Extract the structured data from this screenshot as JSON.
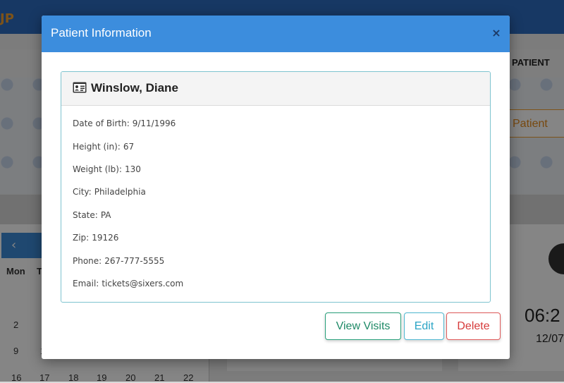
{
  "background": {
    "brand_fragment": "JP",
    "patient_tab": "PATIENT",
    "new_patient_fragment": "w Patient",
    "calendar": {
      "prev": "‹",
      "day_mon": "Mon",
      "day_tue": "T",
      "row1": [
        "2"
      ],
      "row2": [
        "9",
        "1"
      ],
      "row3": [
        "16",
        "17",
        "18",
        "19",
        "20",
        "21",
        "22"
      ]
    },
    "clock_time": "06:2",
    "clock_date": "12/07"
  },
  "modal": {
    "title": "Patient Information",
    "close": "×",
    "patient_name": "Winslow, Diane",
    "fields": [
      {
        "label": "Date of Birth:",
        "value": "9/11/1996"
      },
      {
        "label": "Height (in):",
        "value": "67"
      },
      {
        "label": "Weight (lb):",
        "value": "130"
      },
      {
        "label": "City:",
        "value": "Philadelphia"
      },
      {
        "label": "State:",
        "value": "PA"
      },
      {
        "label": "Zip:",
        "value": "19126"
      },
      {
        "label": "Phone:",
        "value": "267-777-5555"
      },
      {
        "label": "Email:",
        "value": "tickets@sixers.com"
      }
    ],
    "buttons": {
      "view_visits": "View Visits",
      "edit": "Edit",
      "delete": "Delete"
    }
  },
  "colors": {
    "header_blue": "#3c8ddd",
    "card_border": "#7ec3cf",
    "success": "#1f8a67",
    "info": "#2aa4c5",
    "danger": "#d63a3a"
  },
  "icons": {
    "patient_card": "id-card-icon"
  }
}
